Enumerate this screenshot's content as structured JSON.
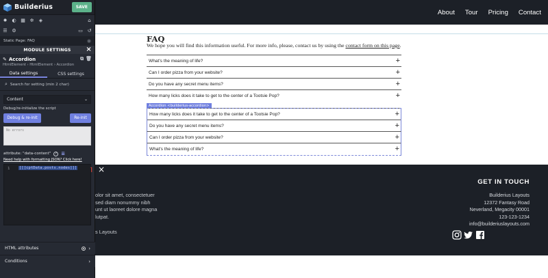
{
  "app": {
    "brand": "Builderius",
    "save_label": "SAVE"
  },
  "static_page": {
    "label": "Static Page: FAQ"
  },
  "module_settings": {
    "title": "MODULE SETTINGS",
    "element_name": "Accordion",
    "breadcrumb": "HtmlElement › HtmlElement › Accordion",
    "tabs": [
      {
        "label": "Data settings"
      },
      {
        "label": "CSS settings"
      }
    ],
    "search_placeholder": "Search for setting (min 2 char)",
    "content_select": "Content",
    "debug_label": "Debug/re-initialize the script",
    "debug_button": "Debug & re-init",
    "reinit_button": "Re-init",
    "errors_text": "No errors",
    "attribute_label": "attribute: \"data-content\"",
    "help_link": "Need help with formatting JSON? Click here!",
    "code_line_number": "1",
    "code_text": "[[[cptData.posts.nodes]]]",
    "sections": [
      {
        "label": "HTML attributes"
      },
      {
        "label": "Conditions"
      }
    ]
  },
  "site": {
    "nav": [
      {
        "label": "About"
      },
      {
        "label": "Tour"
      },
      {
        "label": "Pricing"
      },
      {
        "label": "Contact"
      }
    ],
    "faq": {
      "title": "FAQ",
      "desc_before": "We hope you will find this information useful. For more info, please, contact us by using the ",
      "desc_link": "contact form on this page",
      "desc_after": ".",
      "questions_top": [
        {
          "q": "What's the meaning of life?"
        },
        {
          "q": "Can I order pizza from your website?"
        },
        {
          "q": "Do you have any secret menu items?"
        },
        {
          "q": "How many licks does it take to get to the center of a Tootsie Pop?"
        }
      ],
      "accordion_badge": "Accordion <builderius-accordion>",
      "questions_bottom": [
        {
          "q": "How many licks does it take to get to the center of a Tootsie Pop?"
        },
        {
          "q": "Do you have any secret menu items?"
        },
        {
          "q": "Can I order pizza from your website?"
        },
        {
          "q": "What's the meaning of life?"
        }
      ]
    },
    "footer": {
      "left_lines": [
        "olor sit amet, consectetuer",
        "sed diam nonummy nibh",
        "unt ut laoreet dolore magna",
        "lutpat."
      ],
      "left_bottom": "s Layouts",
      "contact_title": "GET IN TOUCH",
      "contact_lines": [
        "Builderius Layouts",
        "12372 Fantasy Road",
        "Neverland, Megacity 00001",
        "123-123-1234",
        "info@builderiuslayouts.com"
      ],
      "socials": [
        {
          "icon": "instagram-icon"
        },
        {
          "icon": "twitter-icon"
        },
        {
          "icon": "facebook-icon"
        }
      ]
    }
  },
  "colors": {
    "accent": "#7080e0",
    "save": "#5cb28a",
    "dark": "#1c2027",
    "sidebar": "#262a33"
  }
}
